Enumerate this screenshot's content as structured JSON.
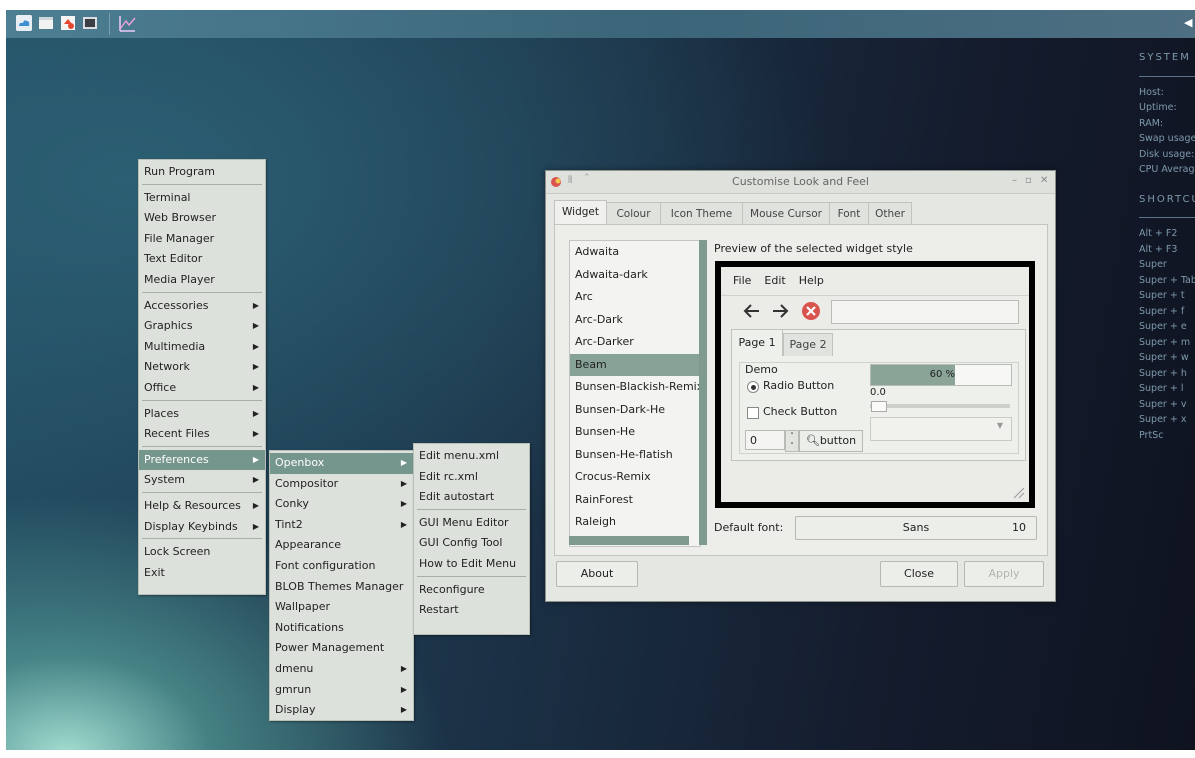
{
  "main_menu": {
    "items": [
      {
        "label": "Run Program",
        "sub": false
      },
      {
        "sep": true
      },
      {
        "label": "Terminal",
        "sub": false
      },
      {
        "label": "Web Browser",
        "sub": false
      },
      {
        "label": "File Manager",
        "sub": false
      },
      {
        "label": "Text Editor",
        "sub": false
      },
      {
        "label": "Media Player",
        "sub": false
      },
      {
        "sep": true
      },
      {
        "label": "Accessories",
        "sub": true
      },
      {
        "label": "Graphics",
        "sub": true
      },
      {
        "label": "Multimedia",
        "sub": true
      },
      {
        "label": "Network",
        "sub": true
      },
      {
        "label": "Office",
        "sub": true
      },
      {
        "sep": true
      },
      {
        "label": "Places",
        "sub": true
      },
      {
        "label": "Recent Files",
        "sub": true
      },
      {
        "sep": true
      },
      {
        "label": "Preferences",
        "sub": true,
        "highlight": true
      },
      {
        "label": "System",
        "sub": true
      },
      {
        "sep": true
      },
      {
        "label": "Help & Resources",
        "sub": true
      },
      {
        "label": "Display Keybinds",
        "sub": true
      },
      {
        "sep": true
      },
      {
        "label": "Lock Screen",
        "sub": false
      },
      {
        "label": "Exit",
        "sub": false
      }
    ]
  },
  "preferences_menu": {
    "items": [
      {
        "label": "Openbox",
        "sub": true,
        "highlight": true
      },
      {
        "label": "Compositor",
        "sub": true
      },
      {
        "label": "Conky",
        "sub": true
      },
      {
        "label": "Tint2",
        "sub": true
      },
      {
        "label": "Appearance",
        "sub": false
      },
      {
        "label": "Font configuration",
        "sub": false
      },
      {
        "label": "BLOB Themes Manager",
        "sub": false
      },
      {
        "label": "Wallpaper",
        "sub": false
      },
      {
        "label": "Notifications",
        "sub": false
      },
      {
        "label": "Power Management",
        "sub": false
      },
      {
        "label": "dmenu",
        "sub": true
      },
      {
        "label": "gmrun",
        "sub": true
      },
      {
        "label": "Display",
        "sub": true
      }
    ]
  },
  "openbox_menu": {
    "items": [
      {
        "label": "Edit menu.xml"
      },
      {
        "label": "Edit rc.xml"
      },
      {
        "label": "Edit autostart"
      },
      {
        "sep": true
      },
      {
        "label": "GUI Menu Editor"
      },
      {
        "label": "GUI Config Tool"
      },
      {
        "label": "How to Edit Menu"
      },
      {
        "sep": true
      },
      {
        "label": "Reconfigure"
      },
      {
        "label": "Restart"
      }
    ]
  },
  "window": {
    "title": "Customise Look and Feel",
    "tabs": [
      "Widget",
      "Colour",
      "Icon Theme",
      "Mouse Cursor",
      "Font",
      "Other"
    ],
    "themes": [
      "Adwaita",
      "Adwaita-dark",
      "Arc",
      "Arc-Dark",
      "Arc-Darker",
      "Beam",
      "Bunsen-Blackish-Remix",
      "Bunsen-Dark-He",
      "Bunsen-He",
      "Bunsen-He-flatish",
      "Crocus-Remix",
      "RainForest",
      "Raleigh"
    ],
    "selected_theme": "Beam",
    "preview_label": "Preview of the selected widget style",
    "preview": {
      "menubar": [
        "File",
        "Edit",
        "Help"
      ],
      "tabs": [
        "Page 1",
        "Page 2"
      ],
      "demo_label": "Demo",
      "radio_label": "Radio Button",
      "check_label": "Check Button",
      "progress_text": "60 %",
      "progress_value": 60,
      "scale_value": "0.0",
      "spin_value": "0",
      "search_button": "button"
    },
    "default_font_label": "Default font:",
    "font_name": "Sans",
    "font_size": "10",
    "about": "About",
    "close": "Close",
    "apply": "Apply"
  },
  "conky": {
    "system_header": "SYSTEM",
    "system_rows": [
      "Host:",
      "Uptime:",
      "RAM:",
      "Swap usage:",
      "Disk usage:",
      "CPU Average:"
    ],
    "shortcuts_header": "SHORTCUTS",
    "shortcut_rows": [
      "Alt + F2",
      "Alt + F3",
      "Super",
      "Super + Tab",
      "Super + t",
      "Super + f",
      "Super + e",
      "Super + m",
      "Super + w",
      "Super + h",
      "Super + l",
      "Super + v",
      "Super + x",
      "PrtSc"
    ]
  },
  "colors": {
    "accent": "#75968c",
    "menu_bg": "#dde1dc",
    "panel": "#3b6579",
    "close_icon": "#d9534f"
  }
}
